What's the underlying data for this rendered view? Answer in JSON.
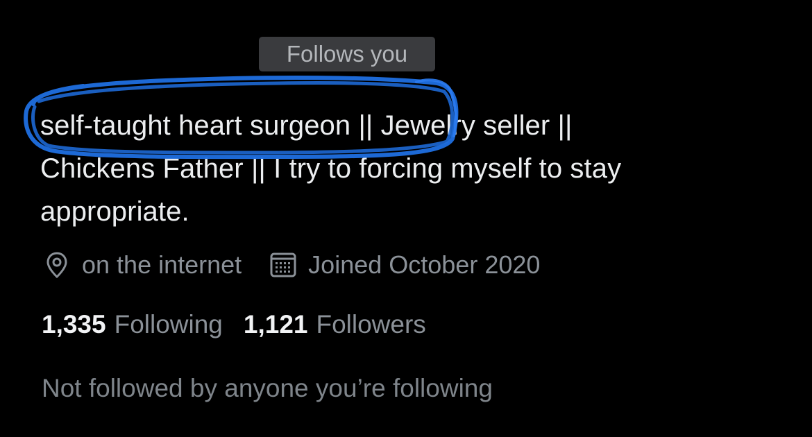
{
  "profile": {
    "follows_you_label": "Follows you",
    "bio": {
      "line1_highlighted": "self-taught heart surgeon ||",
      "line1_rest": " Jewelry seller ||",
      "line2": "Chickens Father || I try to forcing myself to stay",
      "line3": "appropriate."
    },
    "location": "on the internet",
    "joined": "Joined October 2020",
    "following_count": "1,335",
    "following_label": "Following",
    "followers_count": "1,121",
    "followers_label": "Followers",
    "mutuals_note": "Not followed by anyone you’re following",
    "icons": {
      "location": "location-pin-icon",
      "calendar": "calendar-icon"
    },
    "colors": {
      "background": "#000000",
      "primary_text": "#eceef0",
      "secondary_text": "#8b9198",
      "badge_bg": "#3a3b3e",
      "annotation_blue": "#1f6fe0"
    }
  }
}
